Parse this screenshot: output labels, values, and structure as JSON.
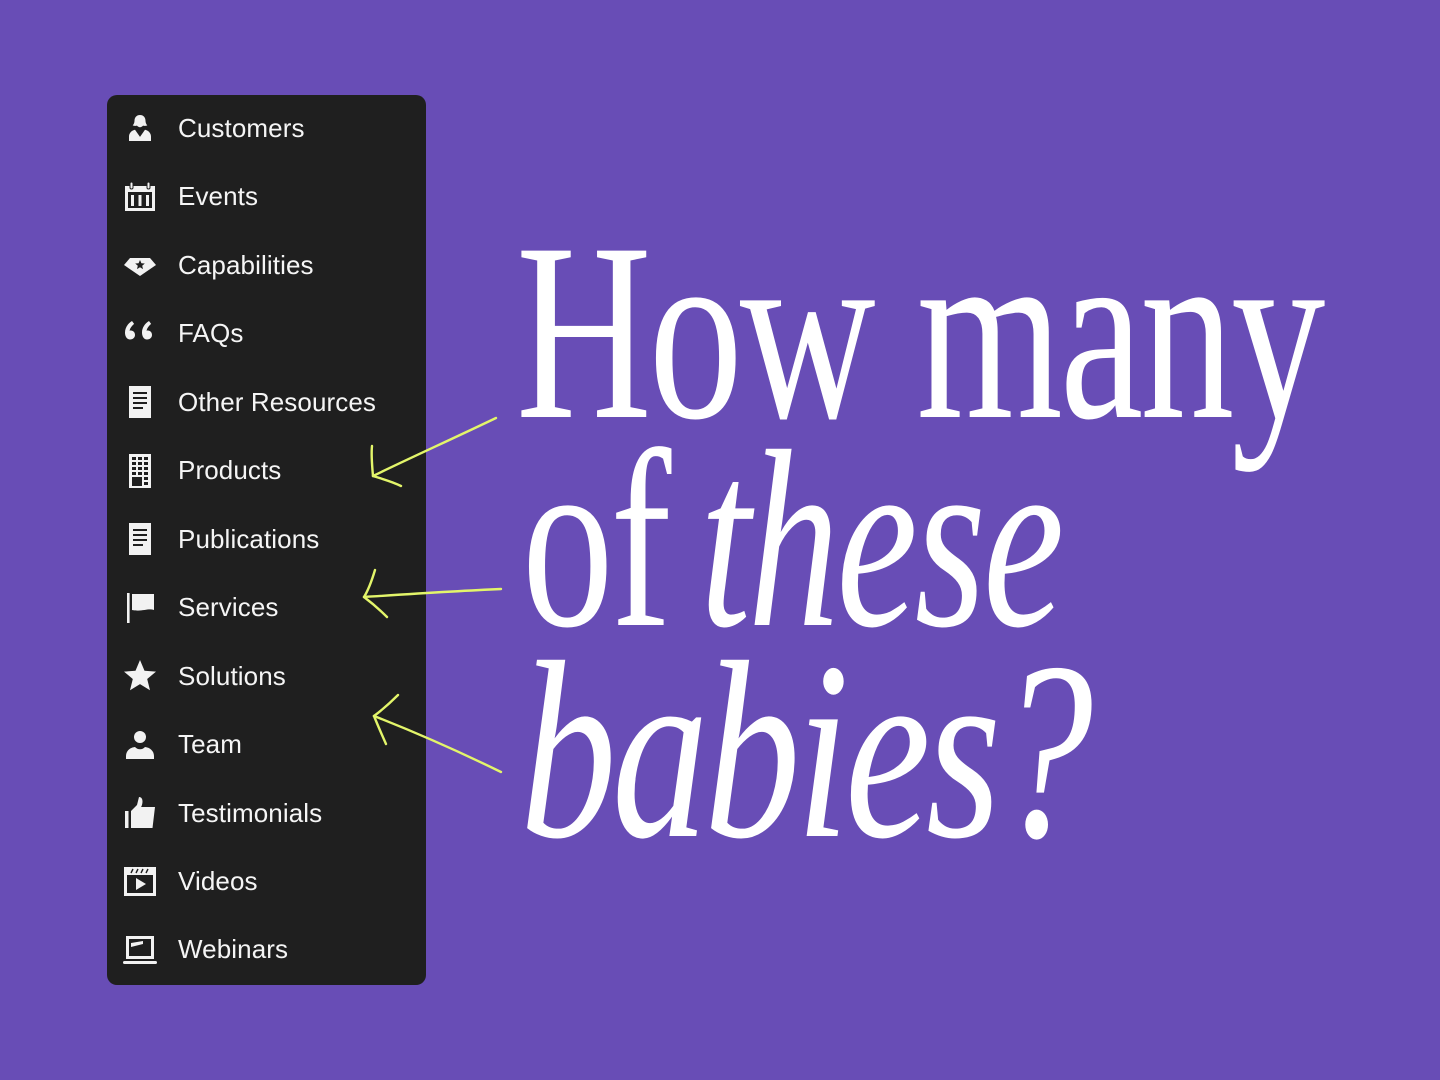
{
  "colors": {
    "background": "#684db6",
    "panel": "#1f1f1f",
    "text": "#f5f5f5",
    "arrow": "#e3f56a",
    "headline": "#ffffff"
  },
  "menu": {
    "items": [
      {
        "label": "Customers",
        "icon": "customer-icon"
      },
      {
        "label": "Events",
        "icon": "calendar-icon"
      },
      {
        "label": "Capabilities",
        "icon": "gem-icon"
      },
      {
        "label": "FAQs",
        "icon": "quote-icon"
      },
      {
        "label": "Other Resources",
        "icon": "document-icon"
      },
      {
        "label": "Products",
        "icon": "building-icon"
      },
      {
        "label": "Publications",
        "icon": "document-icon"
      },
      {
        "label": "Services",
        "icon": "flag-icon"
      },
      {
        "label": "Solutions",
        "icon": "star-icon"
      },
      {
        "label": "Team",
        "icon": "person-icon"
      },
      {
        "label": "Testimonials",
        "icon": "thumbs-up-icon"
      },
      {
        "label": "Videos",
        "icon": "video-icon"
      },
      {
        "label": "Webinars",
        "icon": "laptop-icon"
      }
    ]
  },
  "headline": {
    "line1": "How many",
    "line2_regular": "of",
    "line2_italic": "these",
    "line3_italic": "babies?"
  },
  "annotations": {
    "arrows_point_to": [
      "Products",
      "Services",
      "Solutions"
    ]
  }
}
